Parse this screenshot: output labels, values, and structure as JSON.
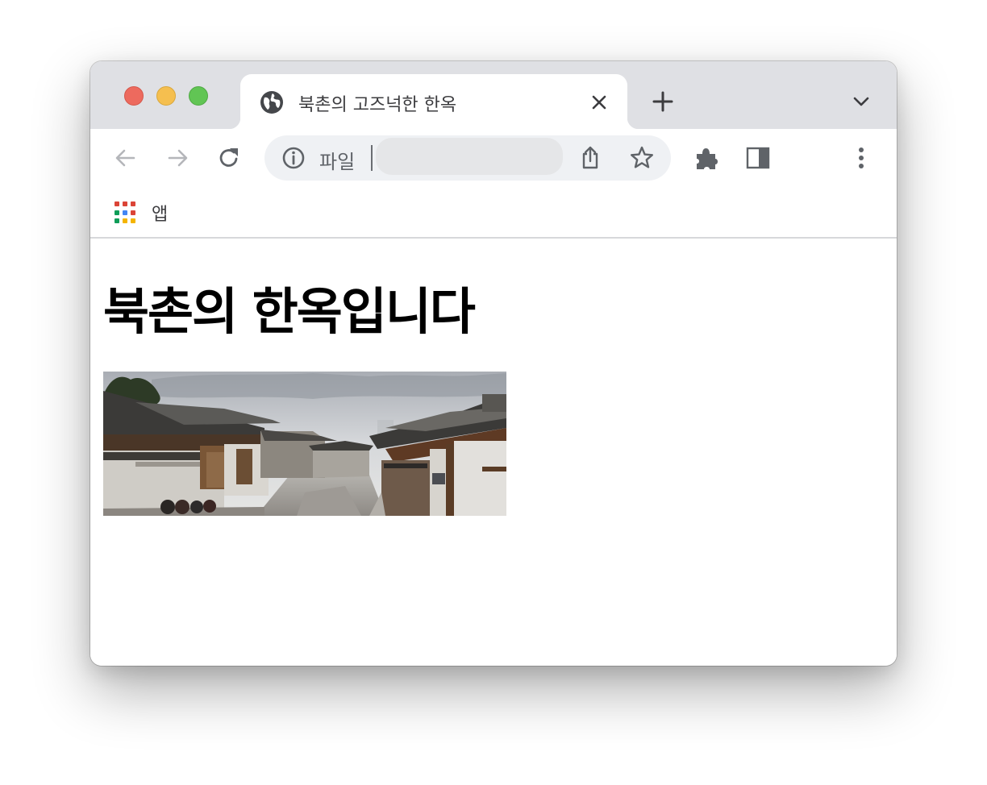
{
  "tab": {
    "title": "북촌의 고즈넉한 한옥",
    "favicon": "globe-icon"
  },
  "toolbar": {
    "back_icon": "arrow-left-icon",
    "forward_icon": "arrow-right-icon",
    "reload_icon": "reload-icon",
    "extensions_icon": "puzzle-icon",
    "side_panel_icon": "side-panel-icon",
    "menu_icon": "more-vertical-icon"
  },
  "omnibox": {
    "scheme_label": "파일",
    "url_value": "",
    "info_icon": "info-icon",
    "share_icon": "share-icon",
    "bookmark_icon": "star-icon"
  },
  "bookmarks": {
    "apps_label": "앱",
    "apps_grid_colors": [
      "#db4437",
      "#db4437",
      "#db4437",
      "#0f9d58",
      "#4285f4",
      "#db4437",
      "#0f9d58",
      "#f4b400",
      "#f4b400"
    ]
  },
  "page": {
    "heading": "북촌의 한옥입니다",
    "image_subject": "bukchon-hanok-village-photo"
  },
  "colors": {
    "tabstrip": "#dfe0e4",
    "omnibox": "#eff1f4",
    "icon": "#5f6368",
    "close_red": "#ed6a5e",
    "minimize_yellow": "#f5bf4f",
    "zoom_green": "#61c554"
  }
}
